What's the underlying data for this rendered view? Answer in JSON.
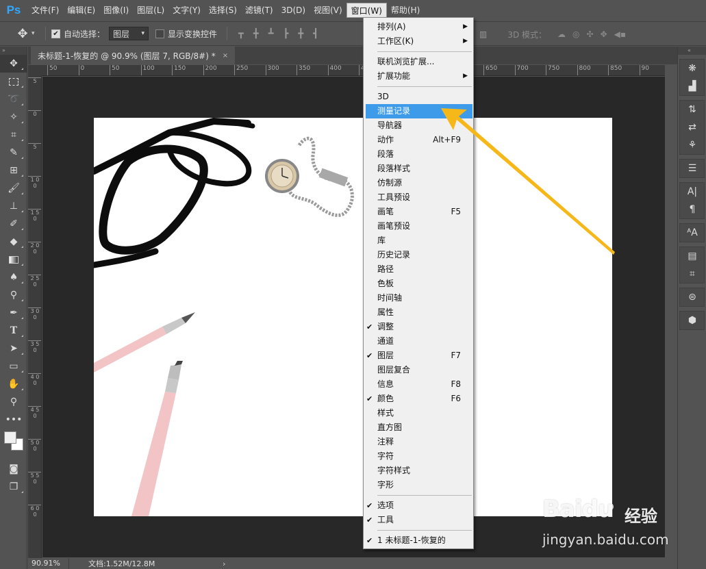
{
  "app": {
    "logo": "Ps",
    "menus": [
      "文件(F)",
      "编辑(E)",
      "图像(I)",
      "图层(L)",
      "文字(Y)",
      "选择(S)",
      "滤镜(T)",
      "3D(D)",
      "视图(V)",
      "窗口(W)",
      "帮助(H)"
    ],
    "open_menu_index": 9
  },
  "options_bar": {
    "auto_select_label": "自动选择：",
    "auto_select_checked": true,
    "auto_select_target": "图层",
    "show_transform_label": "显示变换控件",
    "show_transform_checked": false,
    "mode_3d_label": "3D 模式："
  },
  "document": {
    "tab_title": "未标题-1-恢复的 @ 90.9% (图层 7, RGB/8#) *",
    "tab_close": "×",
    "zoom": "90.91%",
    "doc_info": "文档:1.52M/12.8M",
    "status_arrow": "›"
  },
  "ruler": {
    "h_ticks": [
      "50",
      "0",
      "50",
      "100",
      "150",
      "200",
      "250",
      "300",
      "350",
      "400",
      "450",
      "500",
      "550",
      "600",
      "650",
      "700",
      "750",
      "800",
      "850",
      "90"
    ],
    "v_ticks": [
      "5",
      "0",
      "5",
      "1 0 0",
      "1 5 0",
      "2 0 0",
      "2 5 0",
      "3 0 0",
      "3 5 0",
      "4 0 0",
      "4 5 0",
      "5 0 0",
      "5 5 0",
      "6 0 0"
    ]
  },
  "window_menu": {
    "items": [
      {
        "label": "排列(A)",
        "submenu": true
      },
      {
        "label": "工作区(K)",
        "submenu": true
      },
      {
        "sep": true
      },
      {
        "label": "联机浏览扩展..."
      },
      {
        "label": "扩展功能",
        "submenu": true
      },
      {
        "sep": true
      },
      {
        "label": "3D"
      },
      {
        "label": "测量记录",
        "highlight": true
      },
      {
        "label": "导航器"
      },
      {
        "label": "动作",
        "shortcut": "Alt+F9"
      },
      {
        "label": "段落"
      },
      {
        "label": "段落样式"
      },
      {
        "label": "仿制源"
      },
      {
        "label": "工具预设"
      },
      {
        "label": "画笔",
        "shortcut": "F5"
      },
      {
        "label": "画笔预设"
      },
      {
        "label": "库"
      },
      {
        "label": "历史记录"
      },
      {
        "label": "路径"
      },
      {
        "label": "色板"
      },
      {
        "label": "时间轴"
      },
      {
        "label": "属性"
      },
      {
        "label": "调整",
        "checked": true
      },
      {
        "label": "通道"
      },
      {
        "label": "图层",
        "checked": true,
        "shortcut": "F7"
      },
      {
        "label": "图层复合"
      },
      {
        "label": "信息",
        "shortcut": "F8"
      },
      {
        "label": "颜色",
        "checked": true,
        "shortcut": "F6"
      },
      {
        "label": "样式"
      },
      {
        "label": "直方图"
      },
      {
        "label": "注释"
      },
      {
        "label": "字符"
      },
      {
        "label": "字符样式"
      },
      {
        "label": "字形"
      },
      {
        "sep": true
      },
      {
        "label": "选项",
        "checked": true
      },
      {
        "label": "工具",
        "checked": true
      },
      {
        "sep": true
      },
      {
        "label": "1 未标题-1-恢复的",
        "checked": true
      }
    ]
  },
  "watermark": {
    "brand": "Bai",
    "brand_du": "du",
    "cn": "经验",
    "url": "jingyan.baidu.com"
  },
  "colors": {
    "accent_highlight": "#3d9be9",
    "arrow": "#f6b819",
    "ps_blue": "#31a8ff"
  }
}
